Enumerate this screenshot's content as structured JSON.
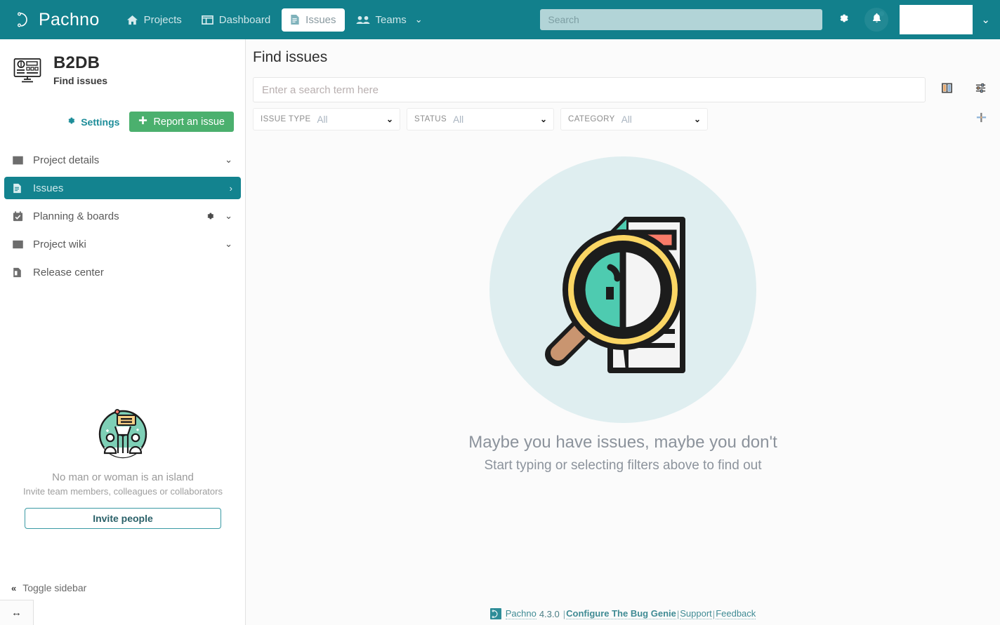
{
  "header": {
    "brand": "Pachno",
    "brand_logo_icon": "pachno-logo-icon",
    "nav": [
      {
        "label": "Projects",
        "icon": "home-icon",
        "active": false
      },
      {
        "label": "Dashboard",
        "icon": "dashboard-icon",
        "active": false
      },
      {
        "label": "Issues",
        "icon": "document-icon",
        "active": true
      },
      {
        "label": "Teams",
        "icon": "users-icon",
        "active": false
      }
    ],
    "teams_caret": "⌄",
    "search_placeholder": "Search",
    "search_value": "",
    "gear_icon": "gear-icon",
    "bell_icon": "bell-icon",
    "user_caret": "⌄",
    "accent_color": "#12808C"
  },
  "sidebar": {
    "project_name": "B2DB",
    "project_subtitle": "Find issues",
    "project_icon": "monitor-icon",
    "settings_label": "Settings",
    "settings_icon": "gear-icon",
    "report_label": "Report an issue",
    "report_icon": "plus-icon",
    "report_color": "#4BB06E",
    "items": [
      {
        "label": "Project details",
        "icon": "columns-icon",
        "active": false,
        "caret": "⌄",
        "gear": false
      },
      {
        "label": "Issues",
        "icon": "document-icon",
        "active": true,
        "caret": "›",
        "gear": false
      },
      {
        "label": "Planning & boards",
        "icon": "calendar-check-icon",
        "active": false,
        "caret": "⌄",
        "gear": true
      },
      {
        "label": "Project wiki",
        "icon": "wiki-icon",
        "active": false,
        "caret": "⌄",
        "gear": false
      },
      {
        "label": "Release center",
        "icon": "release-icon",
        "active": false,
        "caret": "",
        "gear": false
      }
    ],
    "invite": {
      "illustration": "people-celebrating-icon",
      "title": "No man or woman is an island",
      "subtitle": "Invite team members, colleagues or collaborators",
      "button_label": "Invite people"
    },
    "toggle_label": "Toggle sidebar",
    "toggle_icon": "chevron-double-left-icon",
    "resize_icon": "resize-horizontal-icon"
  },
  "main": {
    "title": "Find issues",
    "search_placeholder": "Enter a search term here",
    "search_value": "",
    "columns_icon": "columns-layout-icon",
    "sliders_icon": "sliders-icon",
    "add_filter_icon": "plus-icon",
    "filters": [
      {
        "label": "Issue type",
        "value": "All",
        "caret": "⌄"
      },
      {
        "label": "Status",
        "value": "All",
        "caret": "⌄"
      },
      {
        "label": "Category",
        "value": "All",
        "caret": "⌄"
      }
    ],
    "empty_state": {
      "illustration": "magnifier-document-icon",
      "heading": "Maybe you have issues, maybe you don't",
      "subtext": "Start typing or selecting filters above to find out"
    }
  },
  "footer": {
    "logo_icon": "pachno-logo-icon",
    "product": "Pachno",
    "version": "4.3.0",
    "sep": "|",
    "links": [
      {
        "label": "Configure The Bug Genie",
        "bold": true
      },
      {
        "label": "Support",
        "bold": false
      },
      {
        "label": "Feedback",
        "bold": false
      }
    ]
  }
}
